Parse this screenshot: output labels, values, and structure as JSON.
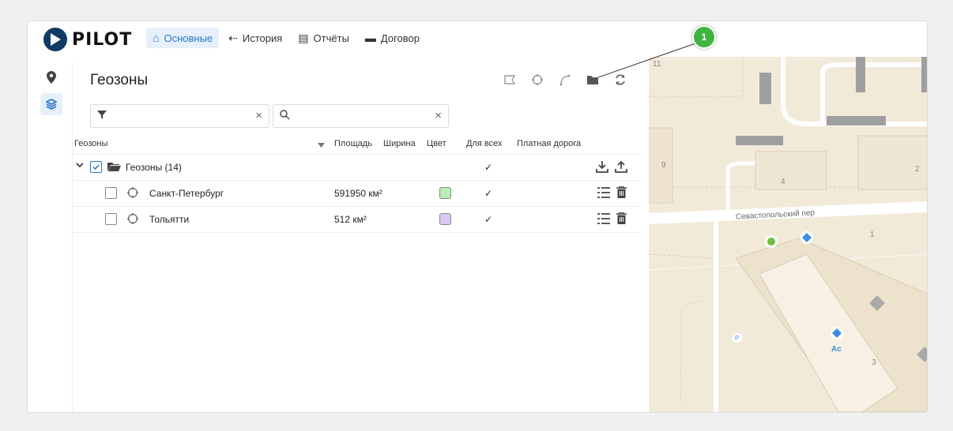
{
  "logo": {
    "text": "PILOT"
  },
  "nav": [
    {
      "label": "Основные",
      "icon": "home-icon",
      "active": true
    },
    {
      "label": "История",
      "icon": "history-icon",
      "active": false
    },
    {
      "label": "Отчёты",
      "icon": "report-icon",
      "active": false
    },
    {
      "label": "Договор",
      "icon": "contract-icon",
      "active": false
    }
  ],
  "sidebar": [
    {
      "icon": "map-marker-icon",
      "active": false
    },
    {
      "icon": "layers-icon",
      "active": true
    }
  ],
  "panel": {
    "title": "Геозоны",
    "tools": [
      "polygon-tool-icon",
      "circle-tool-icon",
      "polyline-tool-icon",
      "folder-icon",
      "refresh-icon"
    ]
  },
  "filters": {
    "filter_value": "",
    "search_value": ""
  },
  "table": {
    "headers": [
      "Геозоны",
      "Площадь",
      "Ширина",
      "Цвет",
      "Для всех",
      "Платная дорога"
    ],
    "group": {
      "label": "Геозоны (14)",
      "for_all": "✓"
    },
    "rows": [
      {
        "name": "Санкт-Петербург",
        "area": "591950 км²",
        "color": "#b7efb7",
        "for_all": "✓"
      },
      {
        "name": "Тольятти",
        "area": "512 км²",
        "color": "#d9c8f5",
        "for_all": "✓"
      }
    ]
  },
  "map": {
    "labels": {
      "street": "Севастопольский пер",
      "h1": "1",
      "h2": "2",
      "h3": "3",
      "h4": "4",
      "h9": "9",
      "h11": "11",
      "poi": "Ac",
      "parking": "P"
    }
  },
  "callout": {
    "number": "1",
    "color": "#3fb43f"
  }
}
